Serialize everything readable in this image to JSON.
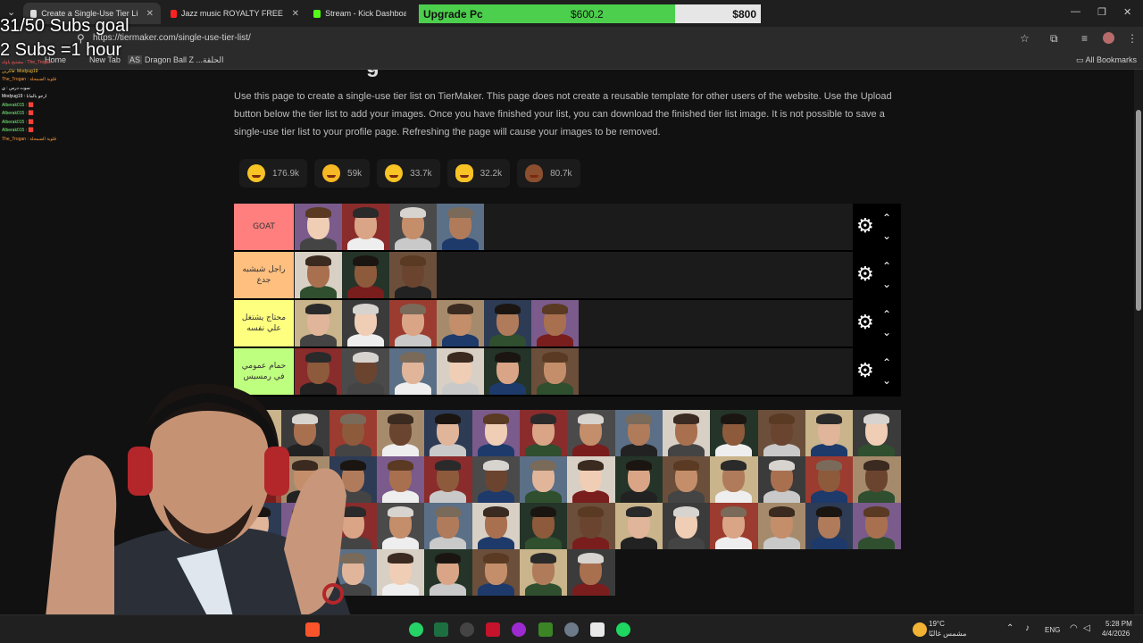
{
  "browser": {
    "tabs": [
      {
        "label": "Create a Single-Use Tier List (P...",
        "active": true,
        "favicon_color": "#dddddd"
      },
      {
        "label": "Jazz music ROYALTY FREE Backg...",
        "active": false,
        "favicon_color": "#ff2222"
      },
      {
        "label": "Stream - Kick Dashboard",
        "active": false,
        "favicon_color": "#53fc18"
      }
    ],
    "url": "https://tiermaker.com/single-use-tier-list/",
    "bookmarks": [
      {
        "label": "Home"
      },
      {
        "label": "New Tab"
      },
      {
        "label": "Dragon Ball Z ...الحلقة"
      }
    ],
    "all_bookmarks": "All Bookmarks"
  },
  "upgrade_widget": {
    "label": "Upgrade Pc",
    "current": "$600.2",
    "goal": "$800",
    "progress": 0.75
  },
  "overlay": {
    "subs_goal": "31/50 Subs goal",
    "subs_rule": "2 Subs =1 hour",
    "chat": [
      "مشتبح ياولد : The_Trogan",
      "فاكرين: Modyug19",
      "The_Trogan : قلوبة الضمحلة",
      "سوت درس : ي",
      "Modyug19 : ارجو بالمانا",
      "Alberak015 : 🟥",
      "Alberak015 : 🟥",
      "Alberak015 : 🟥",
      "Alberak015 : 🟥",
      "The_Trogan : قلوبة الضمحلة"
    ]
  },
  "page": {
    "description": "Use this page to create a single-use tier list on TierMaker. This page does not create a reusable template for other users of the website. Use the Upload button below the tier list to add your images. Once you have finished your list, you can download the finished tier list image. It is not possible to save a single-use tier list to your profile page. Refreshing the page will cause your images to be removed.",
    "reactions": [
      {
        "emoji": "grin-icon",
        "count": "176.9k"
      },
      {
        "emoji": "heart-eyes-icon",
        "count": "59k"
      },
      {
        "emoji": "laugh-icon",
        "count": "33.7k"
      },
      {
        "emoji": "clap-icon",
        "count": "32.2k"
      },
      {
        "emoji": "poop-icon",
        "count": "80.7k"
      }
    ],
    "tiers": [
      {
        "label": "GOAT",
        "color": "#ff7f7f",
        "count": 4
      },
      {
        "label": "راجل شبشبه جدع",
        "color": "#ffbf7f",
        "count": 3
      },
      {
        "label": "محتاج يشتغل علي نفسه",
        "color": "#ffff7f",
        "count": 6
      },
      {
        "label": "حمام عمومي في رمسيس",
        "color": "#bfff7f",
        "count": 6
      }
    ],
    "pool_count": 50
  },
  "taskbar": {
    "weather_temp": "19°C",
    "weather_desc": "مشمس غالبًا",
    "lang": "ENG",
    "time": "5:28 PM",
    "date": "4/4/2026"
  }
}
